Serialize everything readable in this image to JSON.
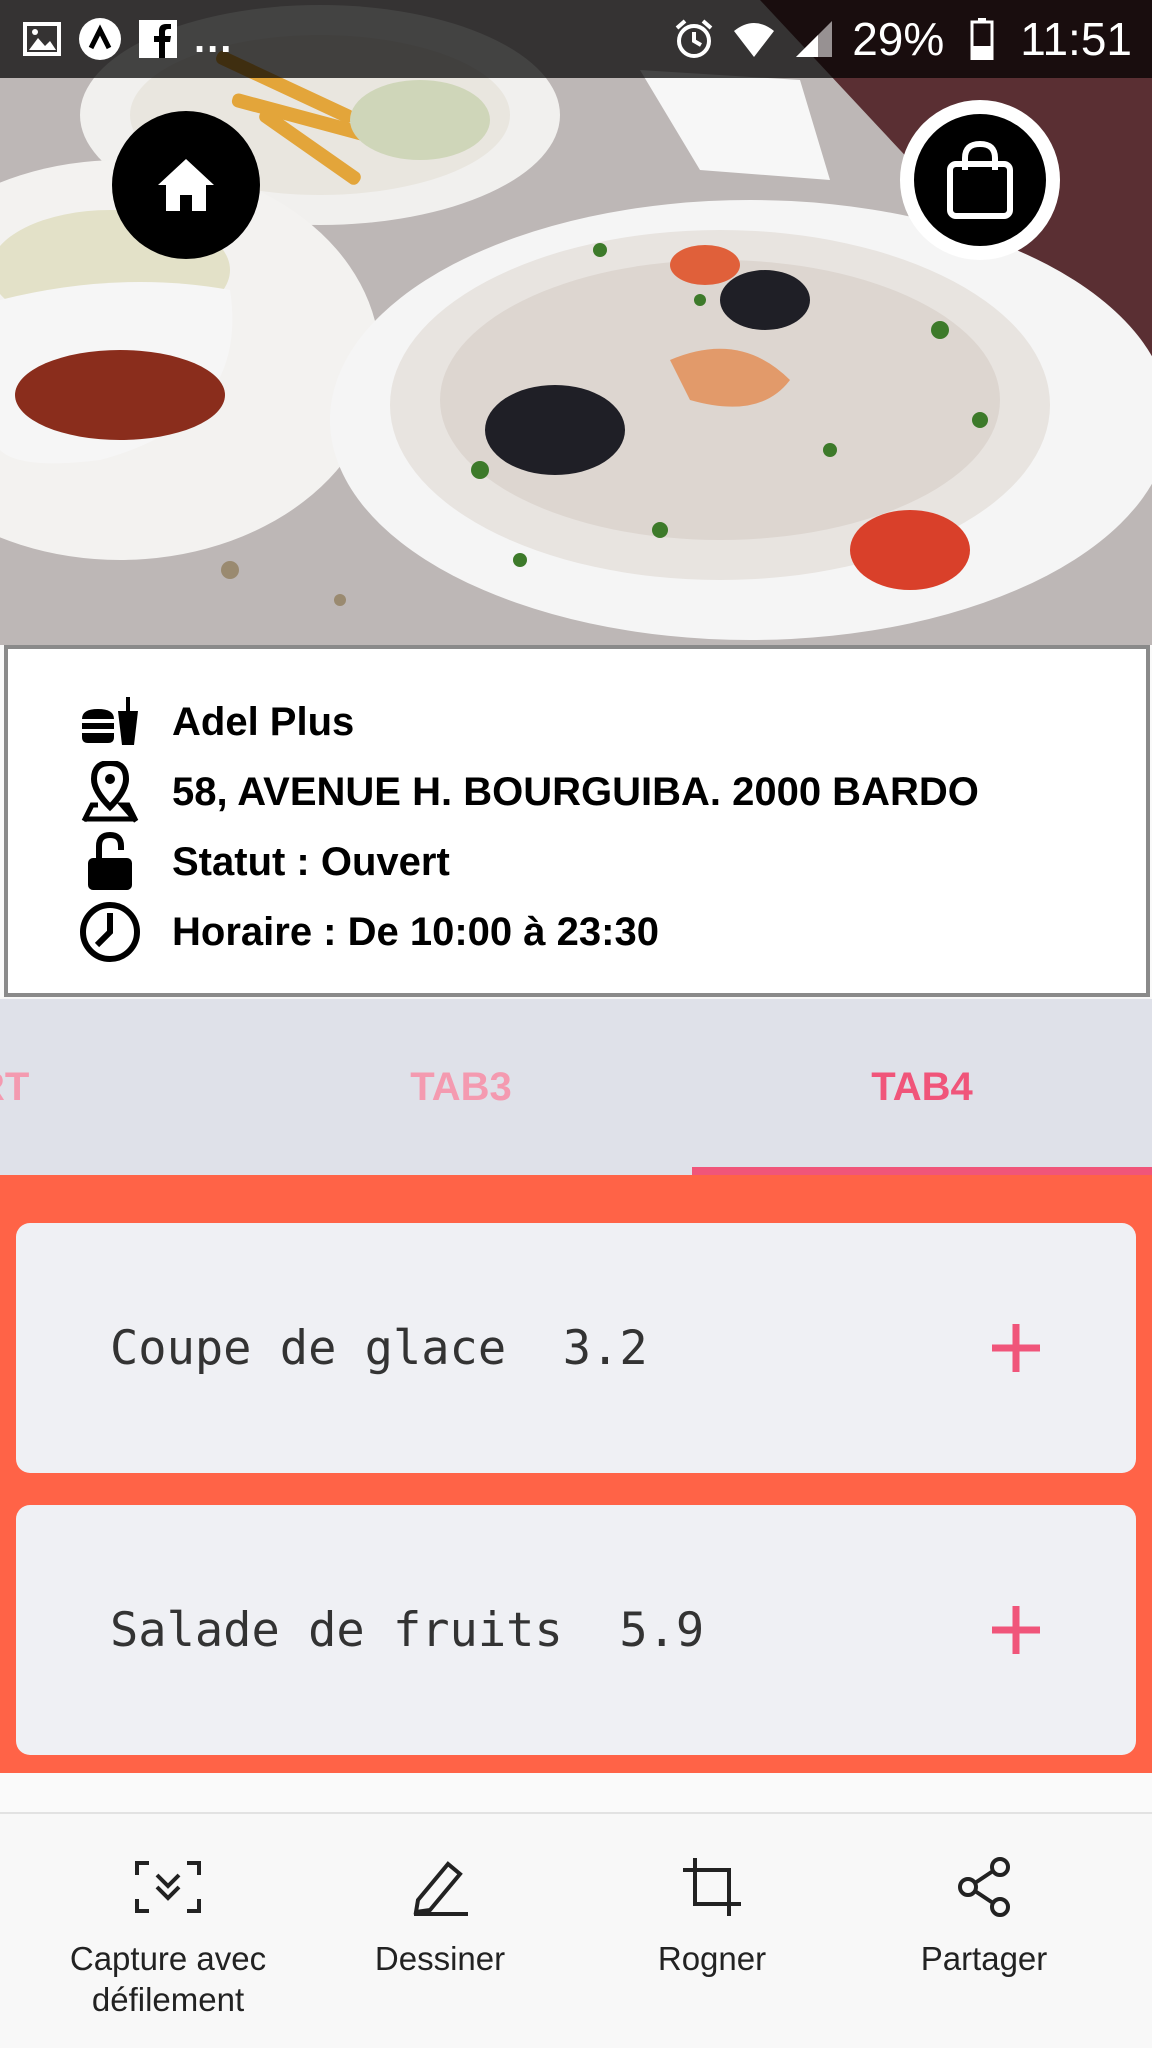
{
  "status_bar": {
    "overflow_dots": "...",
    "battery": "29%",
    "time": "11:51"
  },
  "hero": {
    "home_icon": "home-icon",
    "cart_icon": "shopping-bag-icon"
  },
  "restaurant": {
    "name": "Adel Plus",
    "address": "58, AVENUE H. BOURGUIBA. 2000 BARDO",
    "status": "Statut : Ouvert",
    "hours": "Horaire : De 10:00 à 23:30"
  },
  "tabs": {
    "items": [
      {
        "label": "SERT"
      },
      {
        "label": "TAB3"
      },
      {
        "label": "TAB4"
      }
    ],
    "active": "TAB4"
  },
  "menu_items": [
    {
      "label": "Coupe de glace  3.2"
    },
    {
      "label": "Salade de fruits  5.9"
    }
  ],
  "toolbar": {
    "items": [
      {
        "label": "Capture avec\ndéfilement",
        "icon": "scroll-capture-icon"
      },
      {
        "label": "Dessiner",
        "icon": "pen-icon"
      },
      {
        "label": "Rogner",
        "icon": "crop-icon"
      },
      {
        "label": "Partager",
        "icon": "share-icon"
      }
    ]
  },
  "colors": {
    "accent": "#f0557a",
    "accent_light": "#f49ab0",
    "list_background": "#ff6347",
    "card_background": "#eff0f4",
    "tab_background": "#dfe1e9"
  }
}
